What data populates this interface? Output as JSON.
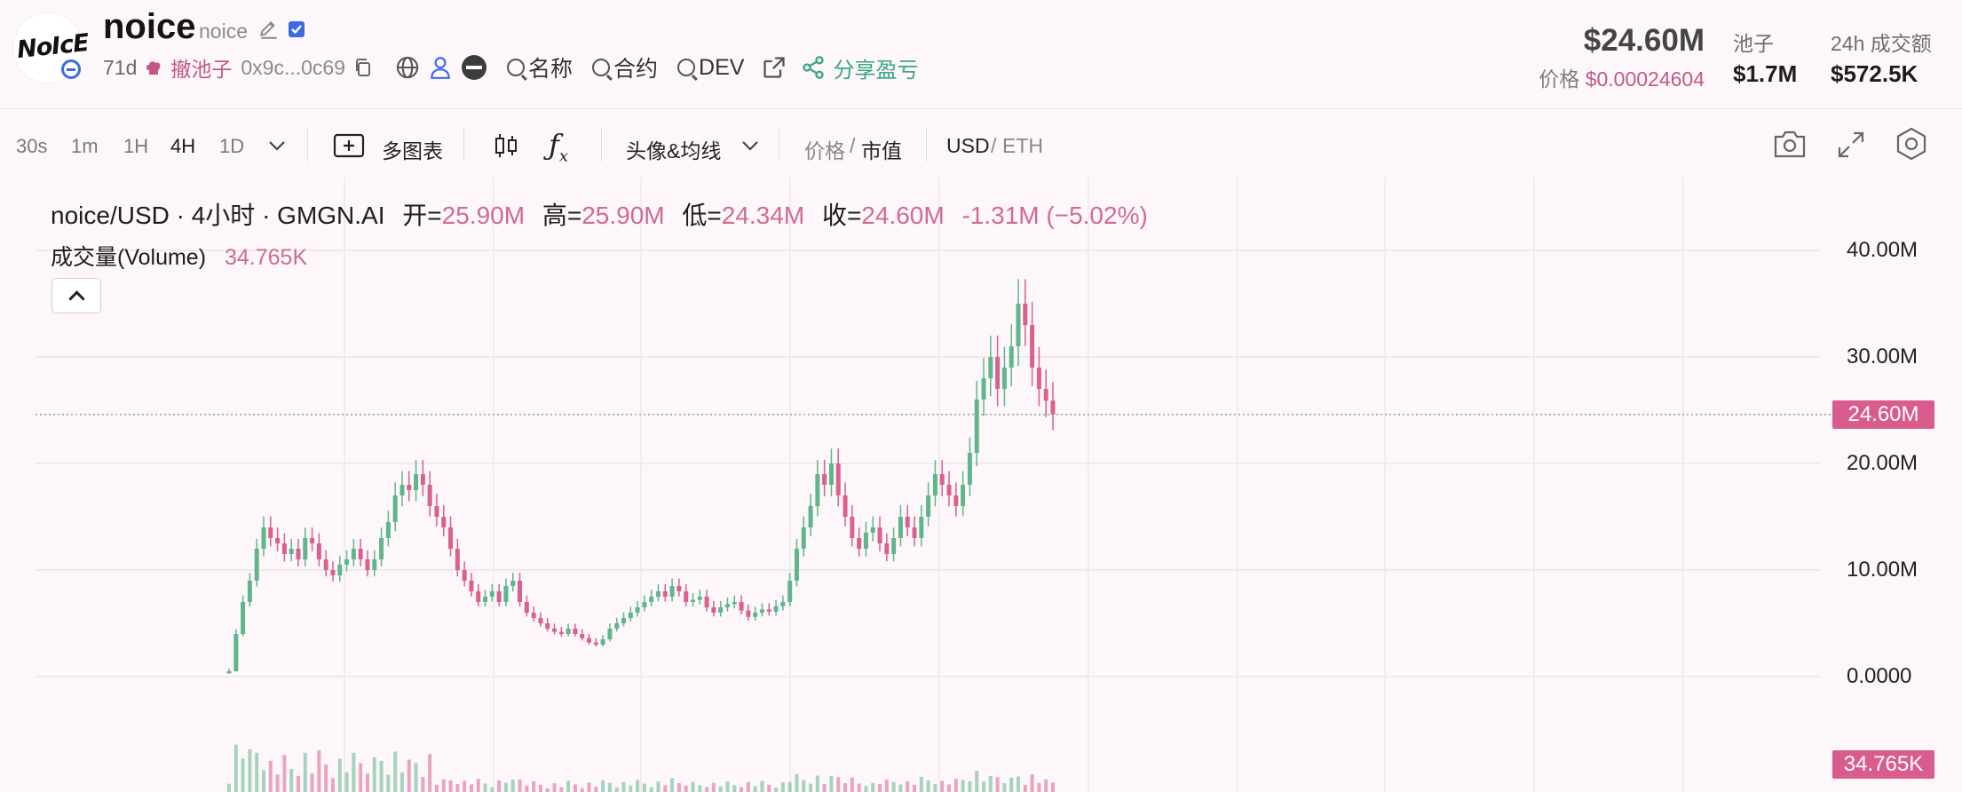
{
  "header": {
    "logo_text": "NoIcE",
    "token_name": "noice",
    "token_symbol": "noice",
    "age": "71d",
    "rug_label": "撤池子",
    "address": "0x9c...0c69",
    "search_name": "名称",
    "search_contract": "合约",
    "search_dev": "DEV",
    "share_label": "分享盈亏",
    "market_cap": "$24.60M",
    "price_label": "价格",
    "price_value": "$0.00024604",
    "pool_label": "池子",
    "pool_value": "$1.7M",
    "volume_label": "24h 成交额",
    "volume_value": "$572.5K"
  },
  "toolbar": {
    "timeframes": [
      "30s",
      "1m",
      "1H",
      "4H",
      "1D"
    ],
    "active_timeframe": "4H",
    "multi_chart": "多图表",
    "avatar_ma": "头像&均线",
    "price_label": "价格",
    "mcap_label": "市值",
    "usd_label": "USD",
    "eth_label": "ETH"
  },
  "legend": {
    "pair": "noice/USD · 4小时 · GMGN.AI",
    "open_k": "开=",
    "open_v": "25.90M",
    "high_k": "高=",
    "high_v": "25.90M",
    "low_k": "低=",
    "low_v": "24.34M",
    "close_k": "收=",
    "close_v": "24.60M",
    "change": "-1.31M (−5.02%)",
    "volume_label": "成交量(Volume)",
    "volume_value": "34.765K"
  },
  "colors": {
    "up": "#5fb68a",
    "down": "#d9608f",
    "accent": "#c2578a",
    "share": "#3aa783"
  },
  "chart_data": {
    "type": "candlestick",
    "y_ticks": [
      "40.00M",
      "30.00M",
      "20.00M",
      "10.00M",
      "0.0000"
    ],
    "ylim": [
      0,
      40
    ],
    "y_unit": "M",
    "current_price_tag": "24.60M",
    "volume_tag": "34.765K",
    "close_series_millions": [
      0.5,
      4,
      7,
      9,
      12,
      14,
      13,
      12.5,
      11.5,
      12,
      11,
      13,
      12.5,
      11,
      10,
      9.5,
      10.5,
      11,
      12,
      11,
      10,
      11,
      13,
      14.5,
      17,
      18,
      17.5,
      19,
      18,
      16,
      15,
      14,
      12,
      10,
      9,
      8,
      7,
      7.5,
      8,
      7,
      8.5,
      9,
      7,
      6,
      5.5,
      5,
      4.5,
      4.2,
      4,
      4.5,
      4,
      3.6,
      3.2,
      3,
      3.5,
      4.5,
      5,
      5.5,
      6,
      6.5,
      7,
      7.5,
      8,
      7.5,
      8.5,
      8,
      7,
      7.2,
      7.5,
      6.5,
      6,
      6.5,
      6.8,
      7,
      6.2,
      5.6,
      6,
      6.3,
      6.1,
      6.6,
      7,
      9,
      12,
      14,
      16,
      19,
      18,
      20,
      17,
      15,
      13,
      12,
      13.5,
      14,
      12.5,
      11.5,
      13,
      15,
      14,
      13,
      15,
      17,
      19,
      18,
      17,
      16,
      18,
      21,
      26,
      28,
      30,
      27,
      29,
      31,
      35,
      33,
      29,
      27,
      25.9,
      24.6
    ]
  }
}
